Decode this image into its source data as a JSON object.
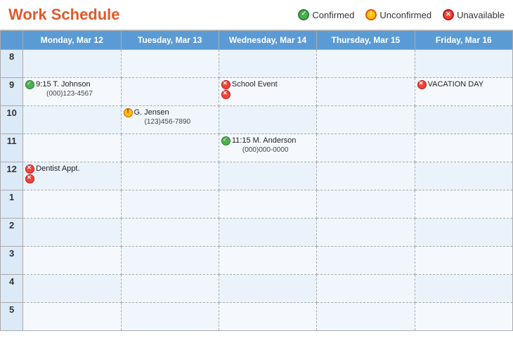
{
  "header": {
    "title": "Work Schedule",
    "legend": {
      "confirmed_label": "Confirmed",
      "unconfirmed_label": "Unconfirmed",
      "unavailable_label": "Unavailable"
    }
  },
  "calendar": {
    "columns": [
      "",
      "Monday, Mar 12",
      "Tuesday, Mar 13",
      "Wednesday, Mar 14",
      "Thursday, Mar 15",
      "Friday, Mar 16"
    ],
    "rows": [
      {
        "hour": "8",
        "cells": [
          "",
          "",
          "",
          "",
          ""
        ]
      },
      {
        "hour": "9",
        "cells": [
          {
            "type": "confirmed",
            "line1": "9:15 T. Johnson",
            "line2": "(000)123-4567"
          },
          "",
          {
            "type": "unavailable",
            "line1": "School Event",
            "extra_icon": true
          },
          "",
          {
            "type": "unavailable",
            "line1": "VACATION DAY"
          }
        ]
      },
      {
        "hour": "10",
        "cells": [
          "",
          {
            "type": "unconfirmed",
            "line1": "G. Jensen",
            "line2": "(123)456-7890"
          },
          "",
          "",
          ""
        ]
      },
      {
        "hour": "11",
        "cells": [
          "",
          "",
          {
            "type": "confirmed",
            "line1": "11:15 M. Anderson",
            "line2": "(000)000-0000"
          },
          "",
          ""
        ]
      },
      {
        "hour": "12",
        "cells": [
          {
            "type": "unavailable",
            "line1": "Dentist Appt.",
            "extra_icon": true
          },
          "",
          "",
          "",
          ""
        ]
      },
      {
        "hour": "1",
        "cells": [
          "",
          "",
          "",
          "",
          ""
        ]
      },
      {
        "hour": "2",
        "cells": [
          "",
          "",
          "",
          "",
          ""
        ]
      },
      {
        "hour": "3",
        "cells": [
          "",
          "",
          "",
          "",
          ""
        ]
      },
      {
        "hour": "4",
        "cells": [
          "",
          "",
          "",
          "",
          ""
        ]
      },
      {
        "hour": "5",
        "cells": [
          "",
          "",
          "",
          "",
          ""
        ]
      }
    ]
  }
}
